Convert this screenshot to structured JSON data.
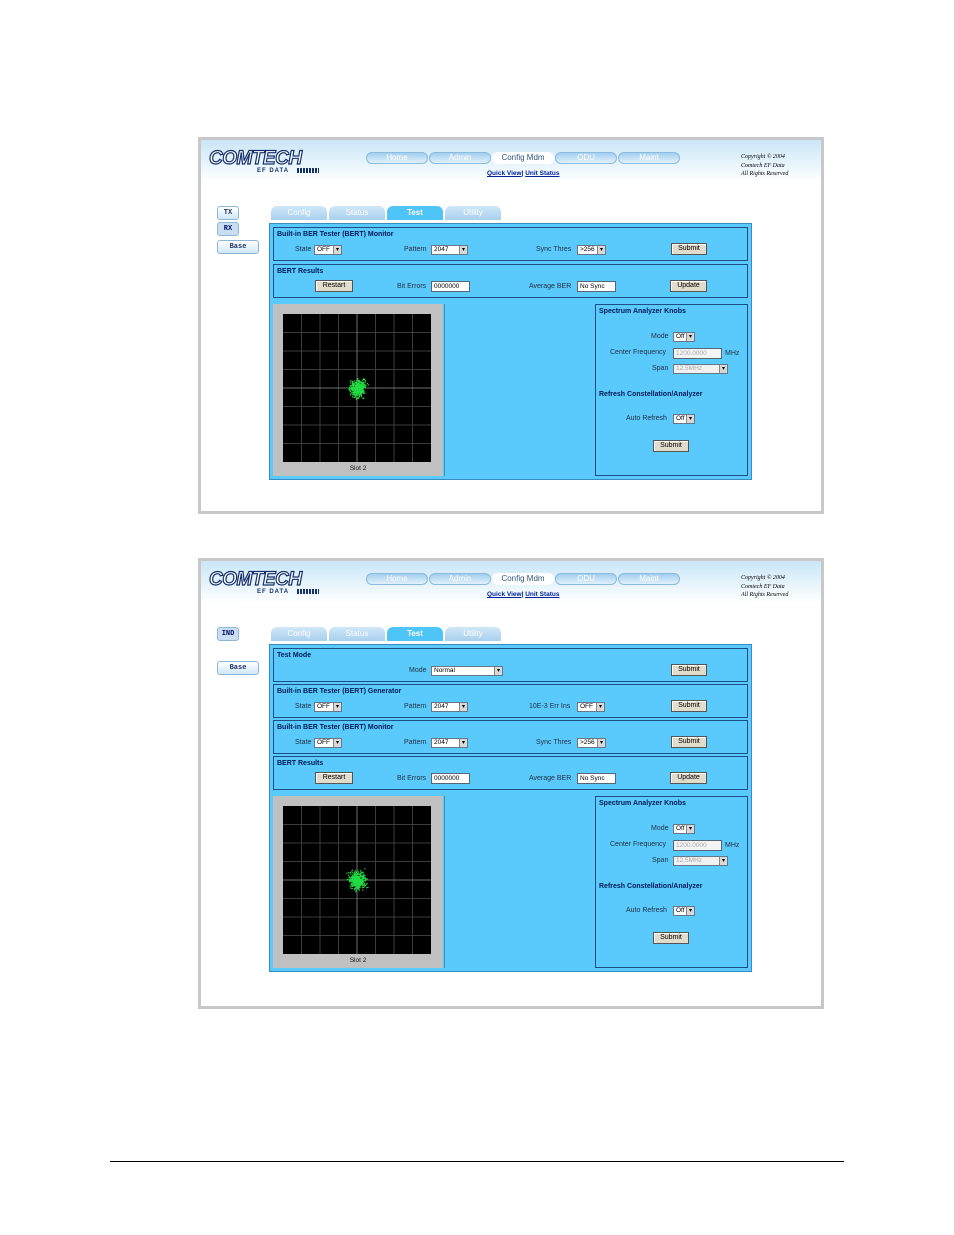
{
  "header": {
    "logo_main": "COMTECH",
    "logo_sub": "EF DATA",
    "nav": [
      "Home",
      "Admin",
      "Config Mdm",
      "ODU",
      "Maint"
    ],
    "nav_active": "Config Mdm",
    "quick_view": "Quick View",
    "unit_status": "Unit Status",
    "copyright": [
      "Copyright © 2004",
      "Comtech EF Data",
      "All Rights Reserved"
    ]
  },
  "tabs": [
    "Config",
    "Status",
    "Test",
    "Utility"
  ],
  "tab_active": "Test",
  "screen1": {
    "side": {
      "tx": "TX",
      "rx": "RX",
      "base": "Base"
    },
    "bert_monitor": {
      "title": "Built-in BER Tester (BERT) Monitor",
      "state_label": "State",
      "state_value": "OFF",
      "pattern_label": "Pattern",
      "pattern_value": "2047",
      "sync_label": "Sync Thres",
      "sync_value": ">256",
      "submit": "Submit"
    },
    "bert_results": {
      "title": "BERT Results",
      "restart": "Restart",
      "bit_errors_label": "Bit Errors",
      "bit_errors_value": "0000000",
      "avg_ber_label": "Average BER",
      "avg_ber_value": "No Sync",
      "update": "Update"
    },
    "constellation": {
      "slot": "Slot 2"
    },
    "knobs": {
      "title": "Spectrum Analyzer Knobs",
      "mode_label": "Mode",
      "mode_value": "Off",
      "cf_label": "Center Frequency",
      "cf_value": "1200.0000",
      "cf_unit": "MHz",
      "span_label": "Span",
      "span_value": "12.5MHz",
      "refresh_title": "Refresh Constellation/Analyzer",
      "auto_refresh_label": "Auto Refresh",
      "auto_refresh_value": "Off",
      "submit": "Submit"
    }
  },
  "screen2": {
    "side": {
      "ind": "IND",
      "base": "Base"
    },
    "test_mode": {
      "title": "Test Mode",
      "mode_label": "Mode",
      "mode_value": "Normal",
      "submit": "Submit"
    },
    "bert_generator": {
      "title": "Built-in BER Tester (BERT) Generator",
      "state_label": "State",
      "state_value": "OFF",
      "pattern_label": "Pattern",
      "pattern_value": "2047",
      "err_label": "10E-3 Err Ins",
      "err_value": "OFF",
      "submit": "Submit"
    },
    "bert_monitor": {
      "title": "Built-in BER Tester (BERT) Monitor",
      "state_label": "State",
      "state_value": "OFF",
      "pattern_label": "Pattern",
      "pattern_value": "2047",
      "sync_label": "Sync Thres",
      "sync_value": ">256",
      "submit": "Submit"
    },
    "bert_results": {
      "title": "BERT Results",
      "restart": "Restart",
      "bit_errors_label": "Bit Errors",
      "bit_errors_value": "0000000",
      "avg_ber_label": "Average BER",
      "avg_ber_value": "No Sync",
      "update": "Update"
    },
    "constellation": {
      "slot": "Slot 2"
    },
    "knobs": {
      "title": "Spectrum Analyzer Knobs",
      "mode_label": "Mode",
      "mode_value": "Off",
      "cf_label": "Center Frequency",
      "cf_value": "1200.0000",
      "cf_unit": "MHz",
      "span_label": "Span",
      "span_value": "12.5MHz",
      "refresh_title": "Refresh Constellation/Analyzer",
      "auto_refresh_label": "Auto Refresh",
      "auto_refresh_value": "Off",
      "submit": "Submit"
    }
  },
  "colors": {
    "panel": "#5ac9fc",
    "border": "#1d4f86",
    "points": "#22dd44",
    "plot_bg": "#000000"
  }
}
